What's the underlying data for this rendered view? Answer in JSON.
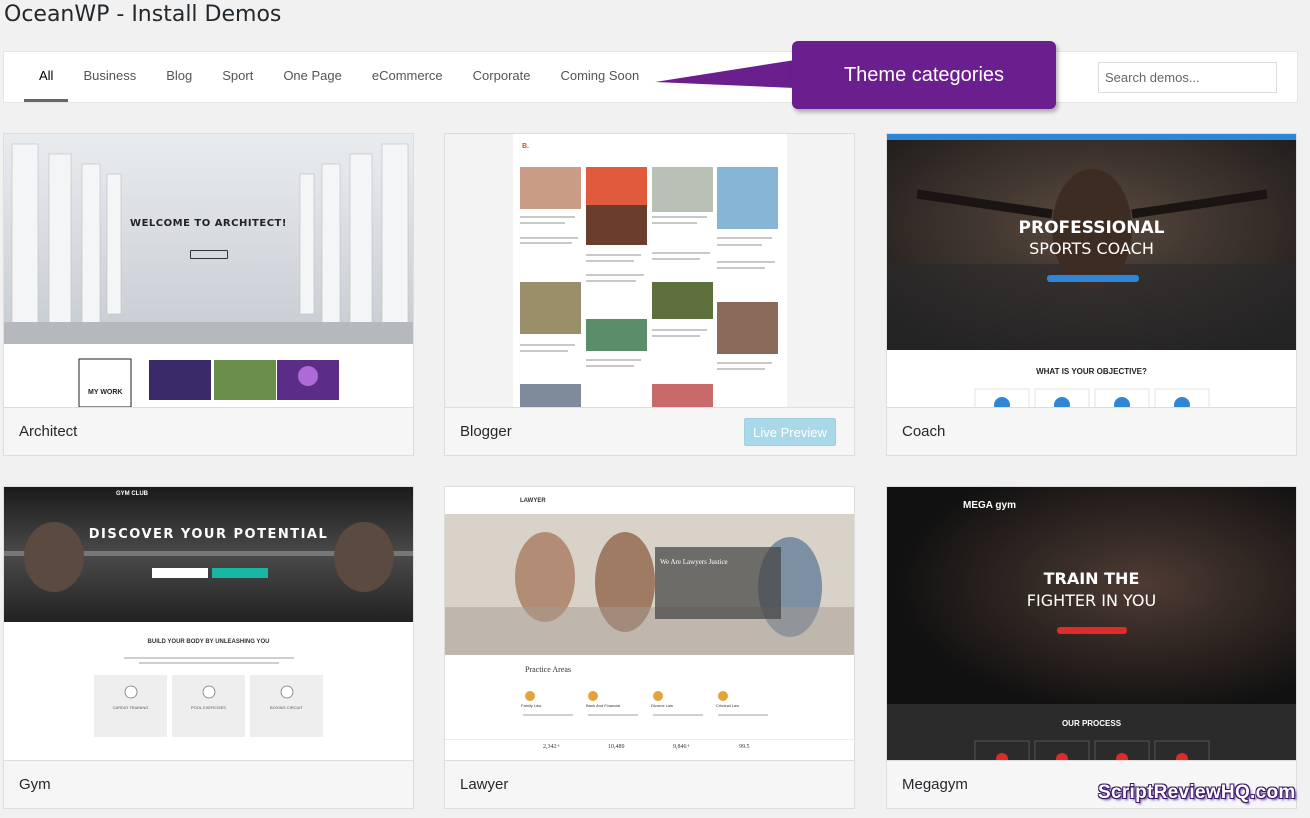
{
  "page": {
    "title": "OceanWP - Install Demos"
  },
  "filters": {
    "tabs": [
      "All",
      "Business",
      "Blog",
      "Sport",
      "One Page",
      "eCommerce",
      "Corporate",
      "Coming Soon"
    ],
    "active": "All",
    "search_placeholder": "Search demos..."
  },
  "callout": {
    "text": "Theme categories"
  },
  "demos": [
    {
      "name": "Architect",
      "hero": "WELCOME TO ARCHITECT!",
      "extra": "MY WORK"
    },
    {
      "name": "Blogger",
      "live_preview": "Live Preview"
    },
    {
      "name": "Coach",
      "hero_line1": "PROFESSIONAL",
      "hero_line2": "SPORTS COACH",
      "section": "WHAT IS YOUR OBJECTIVE?"
    },
    {
      "name": "Gym",
      "hero": "DISCOVER YOUR POTENTIAL",
      "brand": "GYM CLUB",
      "section": "BUILD YOUR BODY BY UNLEASHING YOU",
      "features": [
        "CARDIO TRAINING",
        "POOL EXERCISES",
        "BOXING CIRCUIT"
      ]
    },
    {
      "name": "Lawyer",
      "brand": "LAWYER",
      "hero": "We Are Lawyers Justice",
      "section": "Practice Areas",
      "areas": [
        "Family Law",
        "Bank And Financial",
        "Divorce Law",
        "Criminal Law"
      ],
      "stats": [
        "2,342+",
        "10,489",
        "9,846+",
        "99.5"
      ]
    },
    {
      "name": "Megagym",
      "brand": "MEGA gym",
      "hero_line1": "TRAIN THE",
      "hero_line2": "FIGHTER IN YOU",
      "section": "OUR PROCESS"
    }
  ],
  "watermark": "ScriptReviewHQ.com",
  "colors": {
    "callout": "#6b1f8f",
    "live_preview": "#a9d8e9"
  }
}
